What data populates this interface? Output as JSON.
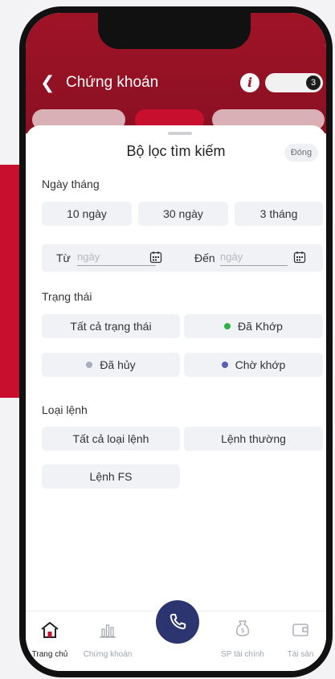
{
  "header": {
    "title": "Chứng khoán",
    "badge_count": "3"
  },
  "filter": {
    "title": "Bộ lọc tìm kiếm",
    "close_label": "Đóng",
    "date_section": {
      "label": "Ngày tháng",
      "quick_ranges": [
        "10 ngày",
        "30 ngày",
        "3 tháng"
      ],
      "from_label": "Từ",
      "from_placeholder": "ngày",
      "to_label": "Đến",
      "to_placeholder": "ngày"
    },
    "status_section": {
      "label": "Trạng thái",
      "options": [
        {
          "label": "Tất cả trạng thái"
        },
        {
          "label": "Đã Khớp",
          "dot": "#2fb344"
        },
        {
          "label": "Đã hủy",
          "dot": "#a9acbc"
        },
        {
          "label": "Chờ khớp",
          "dot": "#5b5fb8"
        }
      ]
    },
    "order_type_section": {
      "label": "Loại lệnh",
      "options": [
        "Tất cả loại lệnh",
        "Lệnh thường",
        "Lệnh FS"
      ]
    }
  },
  "bottom_nav": {
    "items": [
      {
        "label": "Trang chủ",
        "icon": "home-icon",
        "active": true
      },
      {
        "label": "Chứng khoán",
        "icon": "chart-icon"
      },
      {
        "label": "SP tài chính",
        "icon": "money-bag-icon"
      },
      {
        "label": "Tài sản",
        "icon": "wallet-icon"
      }
    ],
    "call_icon": "phone-icon"
  },
  "colors": {
    "brand_red": "#a01327",
    "accent_navy": "#2d3570"
  }
}
